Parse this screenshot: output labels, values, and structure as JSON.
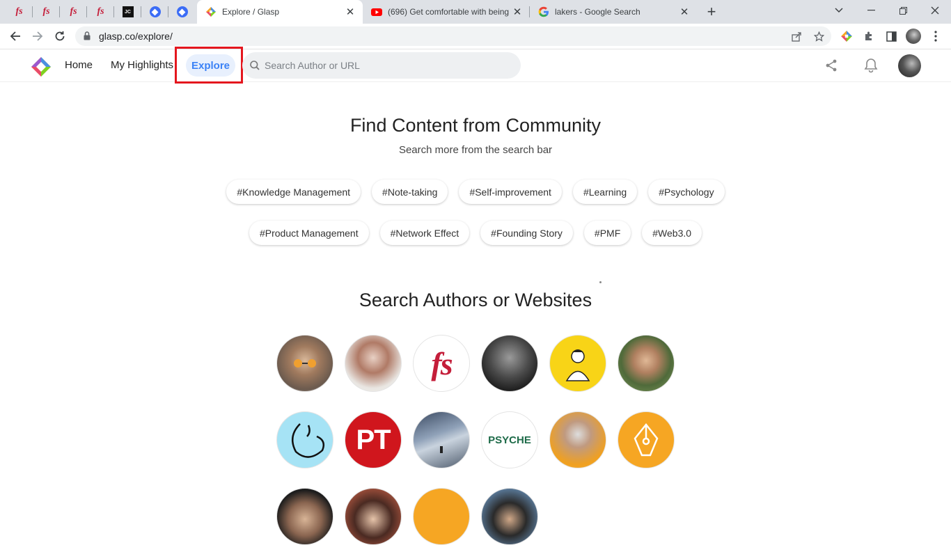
{
  "browser": {
    "pinned_tabs": [
      {
        "icon": "fs-icon",
        "glyph": "fs"
      },
      {
        "icon": "fs-icon",
        "glyph": "fs"
      },
      {
        "icon": "fs-icon",
        "glyph": "fs"
      },
      {
        "icon": "fs-icon",
        "glyph": "fs"
      },
      {
        "icon": "jc-icon",
        "glyph": "JC"
      },
      {
        "icon": "blue-diamond-icon",
        "glyph": ""
      },
      {
        "icon": "blue-diamond-icon",
        "glyph": ""
      }
    ],
    "tabs": [
      {
        "title": "Explore / Glasp",
        "icon": "glasp-icon",
        "active": true
      },
      {
        "title": "(696) Get comfortable with being",
        "icon": "youtube-icon",
        "active": false
      },
      {
        "title": "lakers - Google Search",
        "icon": "google-icon",
        "active": false
      }
    ],
    "url": "glasp.co/explore/"
  },
  "header": {
    "nav": {
      "home": "Home",
      "highlights": "My Highlights",
      "explore": "Explore"
    },
    "search_placeholder": "Search Author or URL"
  },
  "community": {
    "title": "Find Content from Community",
    "subtitle": "Search more from the search bar",
    "tags_row1": [
      "#Knowledge Management",
      "#Note-taking",
      "#Self-improvement",
      "#Learning",
      "#Psychology"
    ],
    "tags_row2": [
      "#Product Management",
      "#Network Effect",
      "#Founding Story",
      "#PMF",
      "#Web3.0"
    ]
  },
  "authors_section": {
    "title": "Search Authors or Websites",
    "authors": [
      {
        "name": "author-1",
        "kind": "photo"
      },
      {
        "name": "author-2",
        "kind": "photo"
      },
      {
        "name": "fs",
        "kind": "logo",
        "text": "fs"
      },
      {
        "name": "author-4",
        "kind": "photo"
      },
      {
        "name": "author-5",
        "kind": "illustration"
      },
      {
        "name": "author-6",
        "kind": "photo"
      },
      {
        "name": "author-7",
        "kind": "logo"
      },
      {
        "name": "pt",
        "kind": "logo",
        "text": "PT"
      },
      {
        "name": "author-9",
        "kind": "photo"
      },
      {
        "name": "psyche",
        "kind": "logo",
        "text": "PSYCHE"
      },
      {
        "name": "author-11",
        "kind": "photo"
      },
      {
        "name": "author-12",
        "kind": "logo"
      },
      {
        "name": "author-13",
        "kind": "photo"
      },
      {
        "name": "author-14",
        "kind": "photo"
      },
      {
        "name": "author-15",
        "kind": "logo"
      },
      {
        "name": "author-16",
        "kind": "photo"
      }
    ]
  },
  "colors": {
    "accent": "#3b82f6",
    "highlight_box": "#e4161e",
    "fs_red": "#c41e3a",
    "pt_red": "#d0161d",
    "psyche_green": "#1e6b49"
  }
}
